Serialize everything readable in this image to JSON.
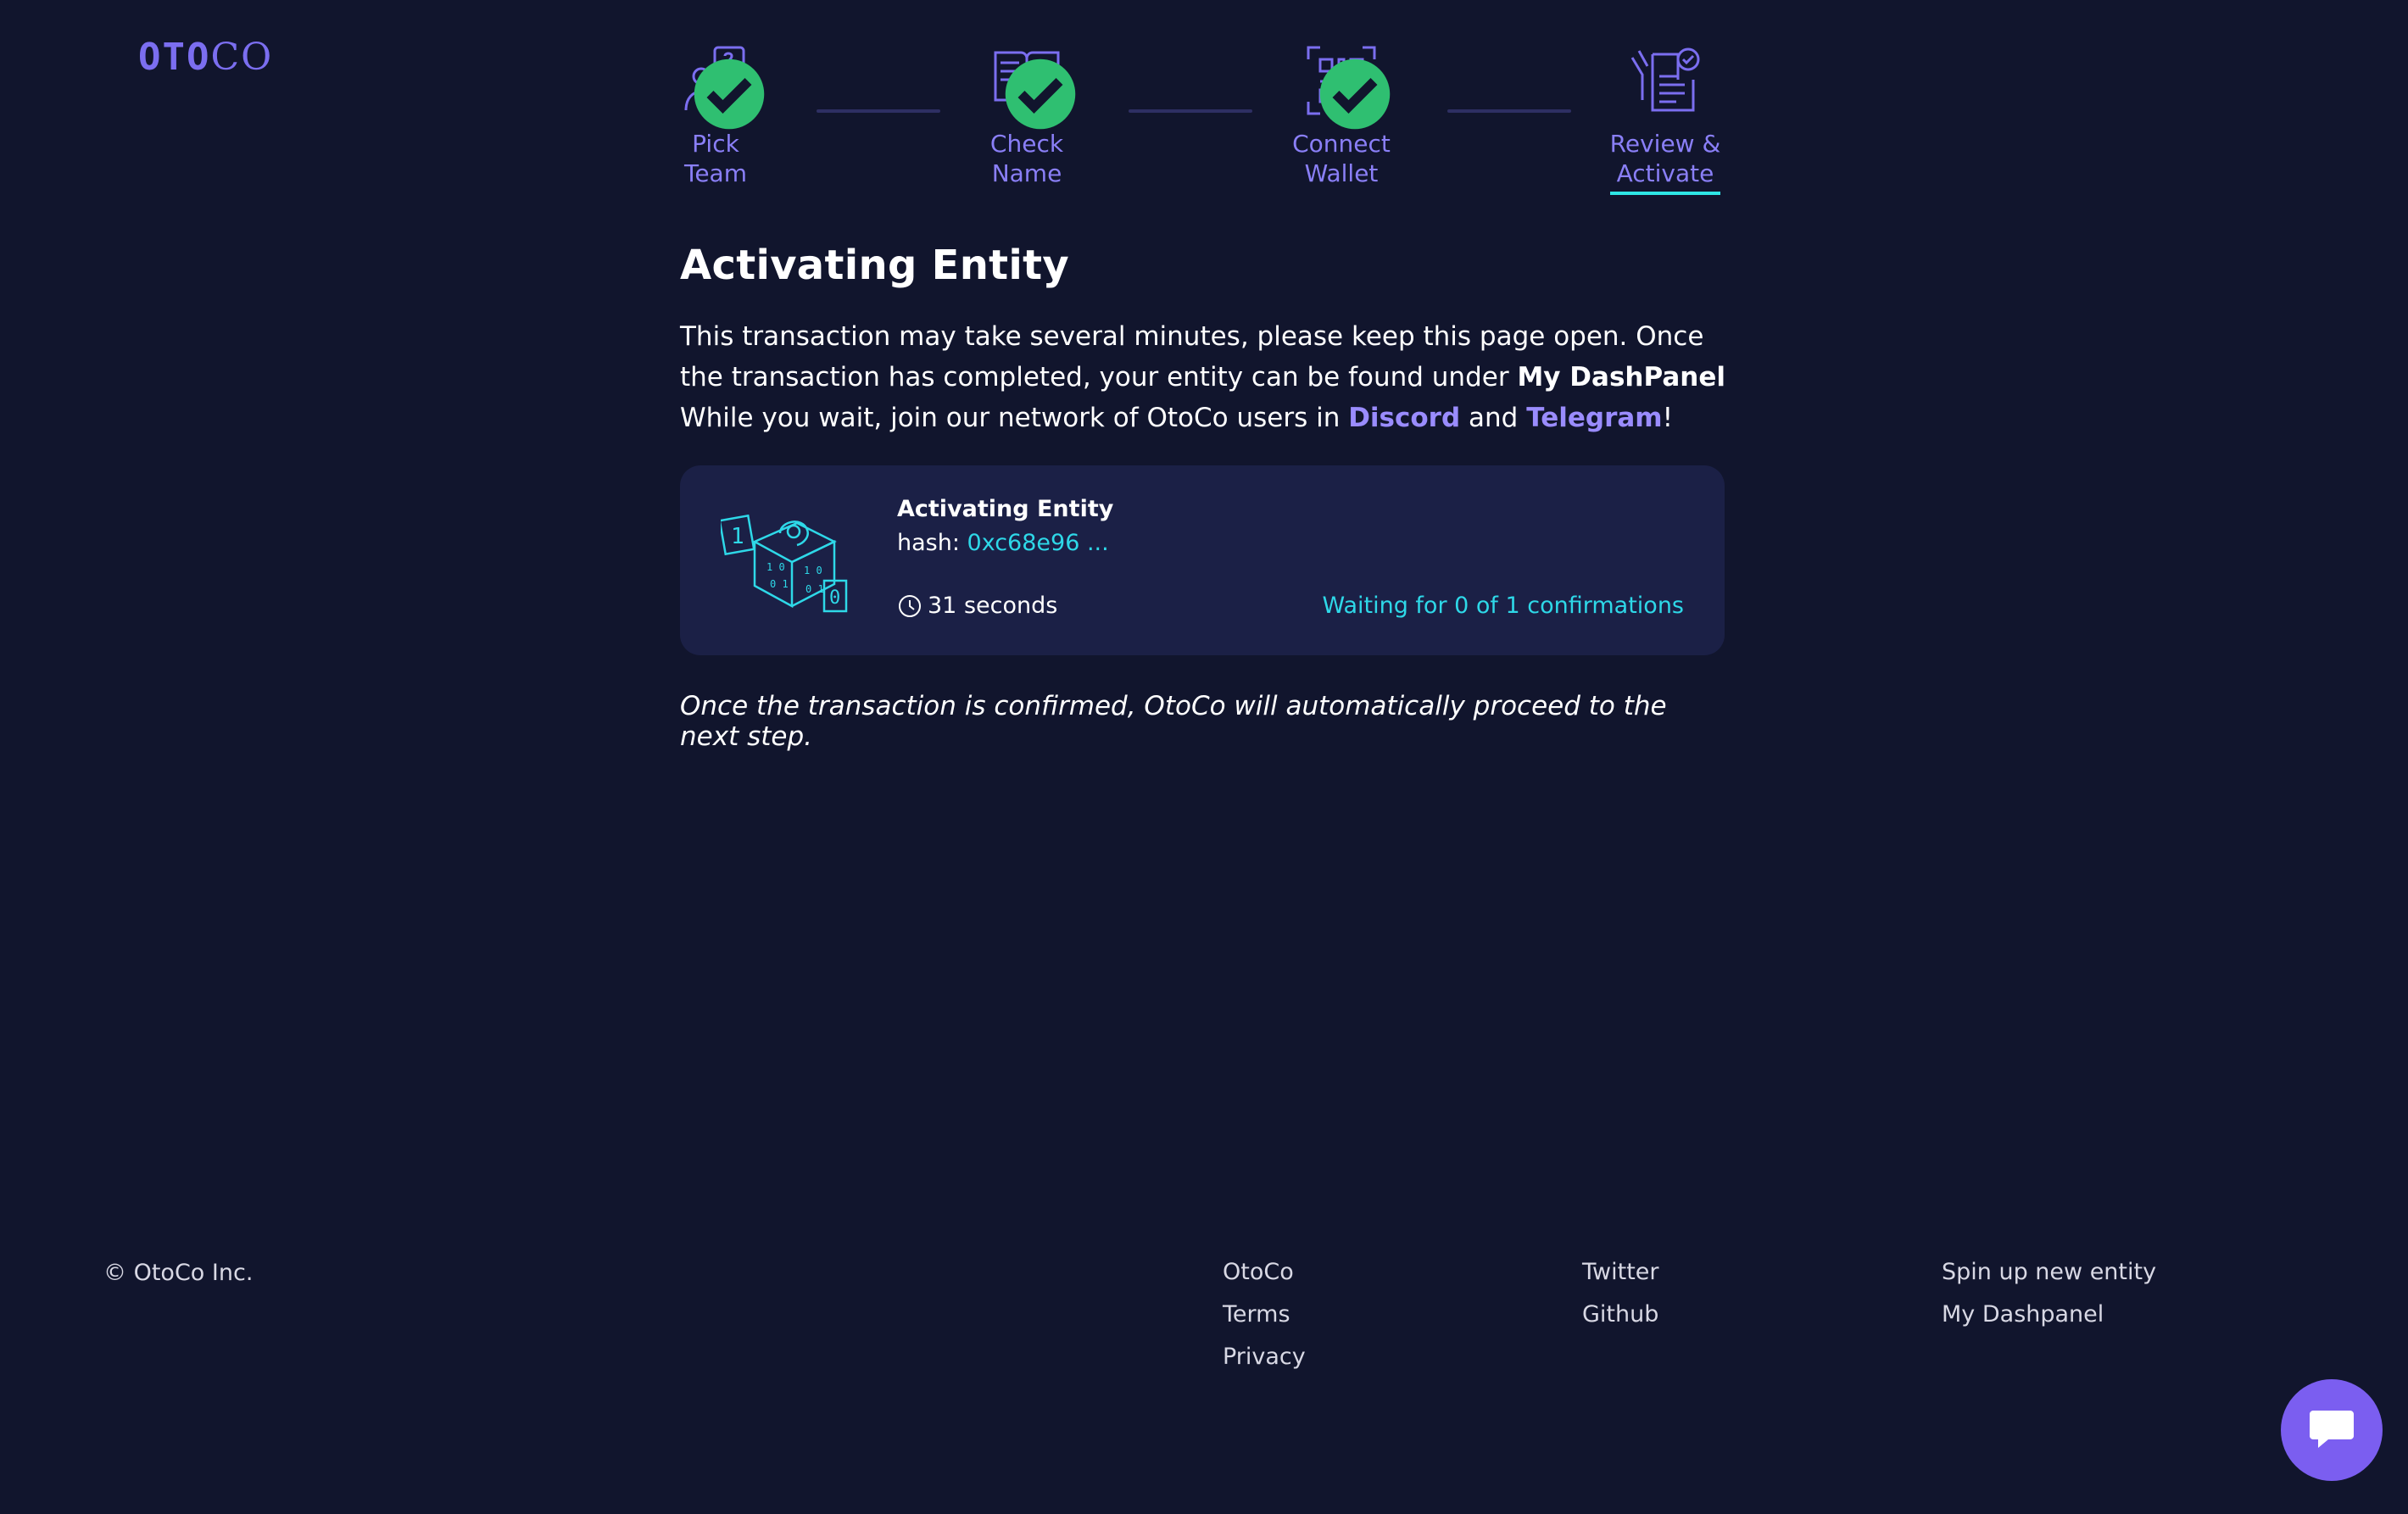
{
  "logo": {
    "left": "OTO",
    "right": "CO"
  },
  "steps": [
    {
      "line1": "Pick",
      "line2": "Team",
      "done": true,
      "icon": "team-question-icon"
    },
    {
      "line1": "Check",
      "line2": "Name",
      "done": true,
      "icon": "open-book-icon"
    },
    {
      "line1": "Connect",
      "line2": "Wallet",
      "done": true,
      "icon": "qr-code-icon"
    },
    {
      "line1": "Review &",
      "line2": "Activate",
      "done": false,
      "active": true,
      "icon": "document-check-icon"
    }
  ],
  "main": {
    "title": "Activating Entity",
    "desc1": "This transaction may take several minutes, please keep this page open. Once the transaction has completed, your entity can be found under ",
    "dashpanel": "My DashPanel",
    "desc2": "While you wait, join our network of OtoCo users in ",
    "discord": "Discord",
    "and": " and ",
    "telegram": "Telegram",
    "excl": "!",
    "note": "Once the transaction is confirmed, OtoCo will automatically proceed to the next step."
  },
  "card": {
    "title": "Activating Entity",
    "hash_label": "hash: ",
    "hash_value": "0xc68e96 ...",
    "time": "31 seconds",
    "confirmations": "Waiting for 0 of 1 confirmations"
  },
  "footer": {
    "copyright": "© OtoCo Inc.",
    "col1": [
      "OtoCo",
      "Terms",
      "Privacy"
    ],
    "col2": [
      "Twitter",
      "Github"
    ],
    "col3": [
      "Spin up new entity",
      "My Dashpanel"
    ]
  },
  "colors": {
    "background": "#11152d",
    "accent": "#8a7ff7",
    "cyan": "#2ed8e8",
    "check": "#2fbf71"
  }
}
